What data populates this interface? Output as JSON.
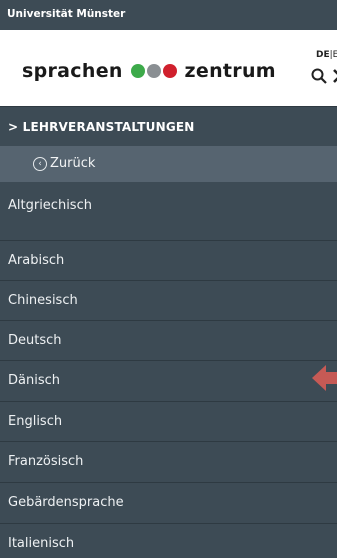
{
  "topbar": {
    "university": "Universität Münster"
  },
  "header": {
    "logo_left": "sprachen",
    "logo_right": "zentrum",
    "dot_colors": [
      "#3daa4a",
      "#8a8f93",
      "#d0202d"
    ],
    "lang_active": "DE",
    "lang_sep": "|",
    "lang_other": "EN"
  },
  "nav": {
    "breadcrumb": "> LEHRVERANSTALTUNGEN",
    "back_label": "Zurück",
    "items": [
      "Altgriechisch",
      "Arabisch",
      "Chinesisch",
      "Deutsch",
      "Dänisch",
      "Englisch",
      "Französisch",
      "Gebärdensprache",
      "Italienisch"
    ]
  },
  "colors": {
    "nav_bg": "#3d4b55",
    "back_bg": "#566470",
    "arrow": "#c65a55"
  }
}
